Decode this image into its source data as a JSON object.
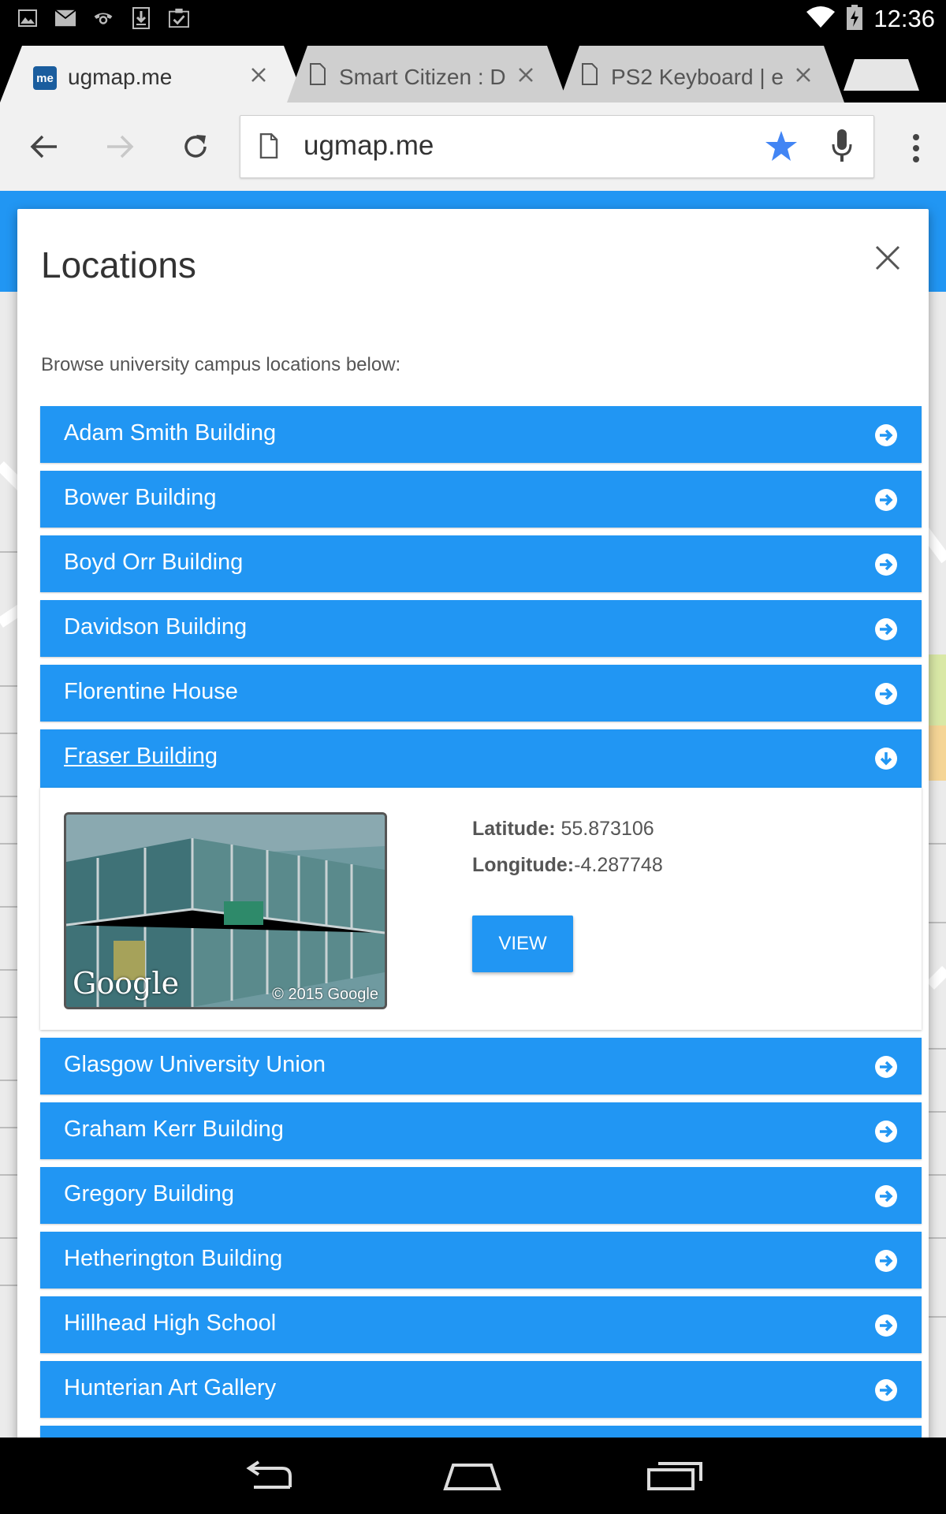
{
  "status_bar": {
    "time": "12:36",
    "icons": [
      "gallery-icon",
      "mail-icon",
      "voicemail-icon",
      "download-icon",
      "clipboard-check-icon",
      "wifi-icon",
      "battery-charging-icon"
    ]
  },
  "tabs": [
    {
      "title": "ugmap.me",
      "favicon_text": "me",
      "active": true
    },
    {
      "title": "Smart Citizen : De",
      "active": false
    },
    {
      "title": "PS2 Keyboard | e",
      "active": false
    }
  ],
  "omnibox": {
    "url": "ugmap.me"
  },
  "modal": {
    "title": "Locations",
    "intro": "Browse university campus locations below:",
    "locations": [
      {
        "label": "Adam Smith Building"
      },
      {
        "label": "Bower Building"
      },
      {
        "label": "Boyd Orr Building"
      },
      {
        "label": "Davidson Building"
      },
      {
        "label": "Florentine House"
      },
      {
        "label": "Fraser Building"
      },
      {
        "label": "Glasgow University Union"
      },
      {
        "label": "Graham Kerr Building"
      },
      {
        "label": "Gregory Building"
      },
      {
        "label": "Hetherington Building"
      },
      {
        "label": "Hillhead High School"
      },
      {
        "label": "Hunterian Art Gallery"
      }
    ],
    "expanded": {
      "latitude_label": "Latitude:",
      "latitude": " 55.873106",
      "longitude_label": "Longitude:",
      "longitude": "-4.287748",
      "view_button": "VIEW",
      "thumb_logo": "Google",
      "thumb_copyright": "© 2015 Google"
    }
  },
  "colors": {
    "accent": "#2196f3",
    "star": "#4285f4"
  }
}
